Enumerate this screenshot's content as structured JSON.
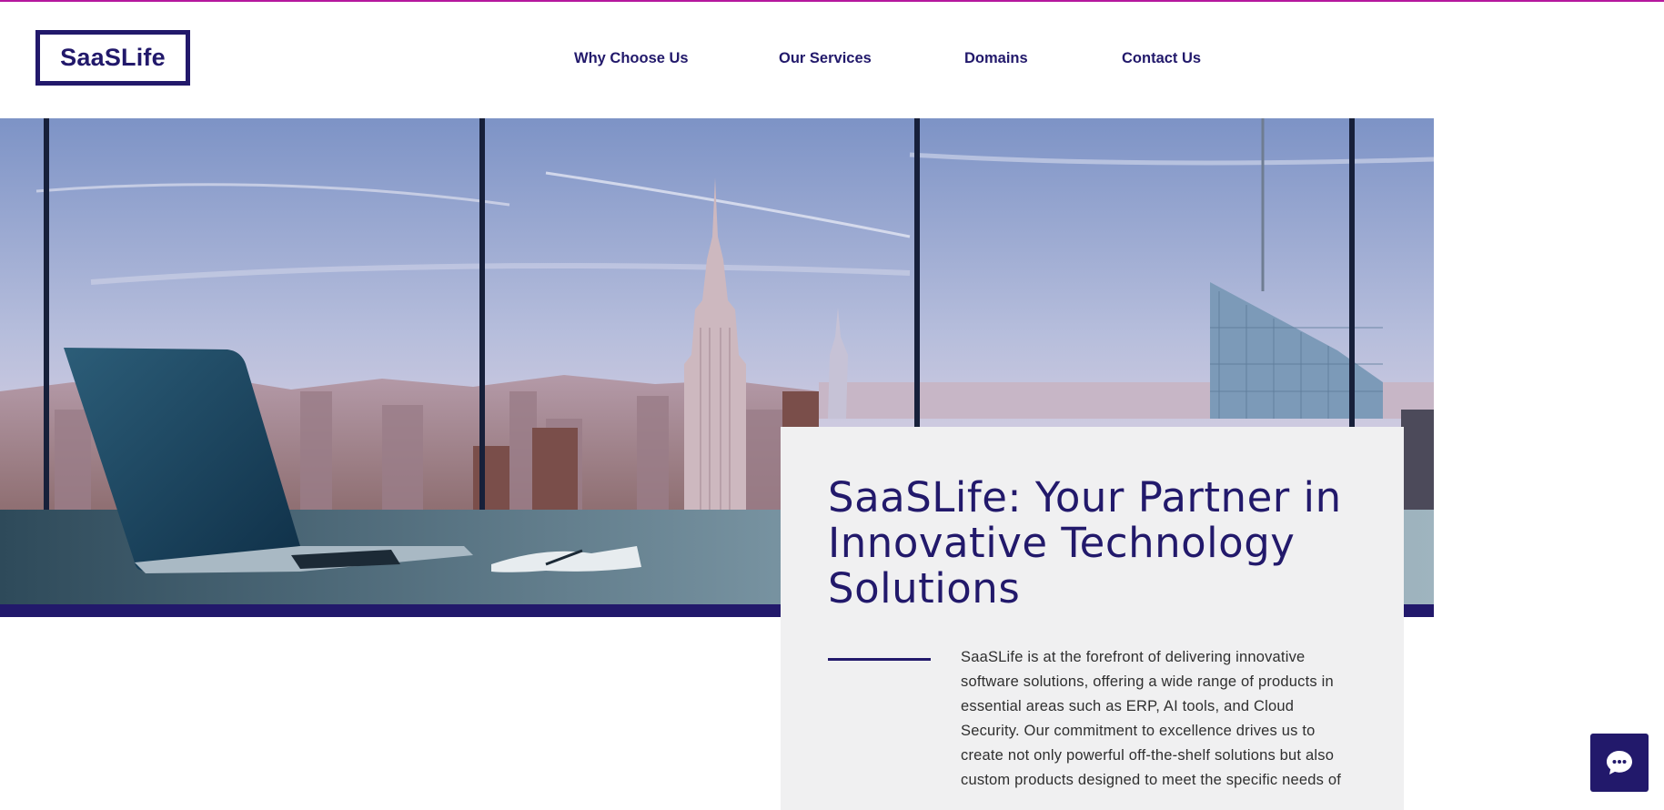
{
  "brand": {
    "logo_text": "SaaSLife"
  },
  "nav": {
    "items": [
      {
        "label": "Why Choose Us"
      },
      {
        "label": "Our Services"
      },
      {
        "label": "Domains"
      },
      {
        "label": "Contact Us"
      }
    ]
  },
  "hero": {
    "title": "SaaSLife: Your Partner in Innovative Technology Solutions",
    "body": "SaaSLife is at the forefront of delivering innovative software solutions, offering a wide range of products in essential areas such as ERP, AI tools, and Cloud Security. Our commitment to excellence drives us to create not only powerful off-the-shelf solutions but also custom products designed to meet the specific needs of"
  },
  "chat": {
    "icon": "chat-bubble-icon"
  },
  "colors": {
    "brand": "#22196b",
    "accent": "#b5179e",
    "card_bg": "#f0f0f1"
  }
}
